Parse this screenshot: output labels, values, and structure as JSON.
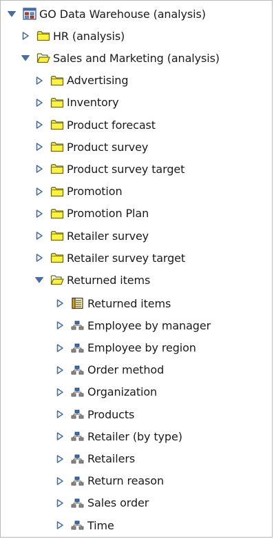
{
  "tree": {
    "root": {
      "label": "GO Data Warehouse (analysis)",
      "icon": "package-icon",
      "state": "expanded"
    },
    "hr": {
      "label": "HR (analysis)",
      "icon": "folder-icon",
      "state": "collapsed"
    },
    "sales": {
      "label": "Sales and Marketing (analysis)",
      "icon": "folder-open-icon",
      "state": "expanded"
    },
    "sales_children": [
      {
        "label": "Advertising",
        "icon": "folder-icon"
      },
      {
        "label": "Inventory",
        "icon": "folder-icon"
      },
      {
        "label": "Product forecast",
        "icon": "folder-icon"
      },
      {
        "label": "Product survey",
        "icon": "folder-icon"
      },
      {
        "label": "Product survey target",
        "icon": "folder-icon"
      },
      {
        "label": "Promotion",
        "icon": "folder-icon"
      },
      {
        "label": "Promotion Plan",
        "icon": "folder-icon"
      },
      {
        "label": "Retailer survey",
        "icon": "folder-icon"
      },
      {
        "label": "Retailer survey target",
        "icon": "folder-icon"
      }
    ],
    "returned": {
      "label": "Returned items",
      "icon": "folder-open-icon",
      "state": "expanded"
    },
    "returned_children": [
      {
        "label": "Returned items",
        "icon": "measure-dimension-icon"
      },
      {
        "label": "Employee by manager",
        "icon": "dimension-icon"
      },
      {
        "label": "Employee by region",
        "icon": "dimension-icon"
      },
      {
        "label": "Order method",
        "icon": "dimension-icon"
      },
      {
        "label": "Organization",
        "icon": "dimension-icon"
      },
      {
        "label": "Products",
        "icon": "dimension-icon"
      },
      {
        "label": "Retailer (by type)",
        "icon": "dimension-icon"
      },
      {
        "label": "Retailers",
        "icon": "dimension-icon"
      },
      {
        "label": "Return reason",
        "icon": "dimension-icon"
      },
      {
        "label": "Sales order",
        "icon": "dimension-icon"
      },
      {
        "label": "Time",
        "icon": "dimension-icon"
      }
    ]
  },
  "colors": {
    "twisty": "#4a6f9e",
    "folder_fill": "#fff23a",
    "folder_stroke": "#6b6b1a",
    "text": "#1a1a1a"
  }
}
